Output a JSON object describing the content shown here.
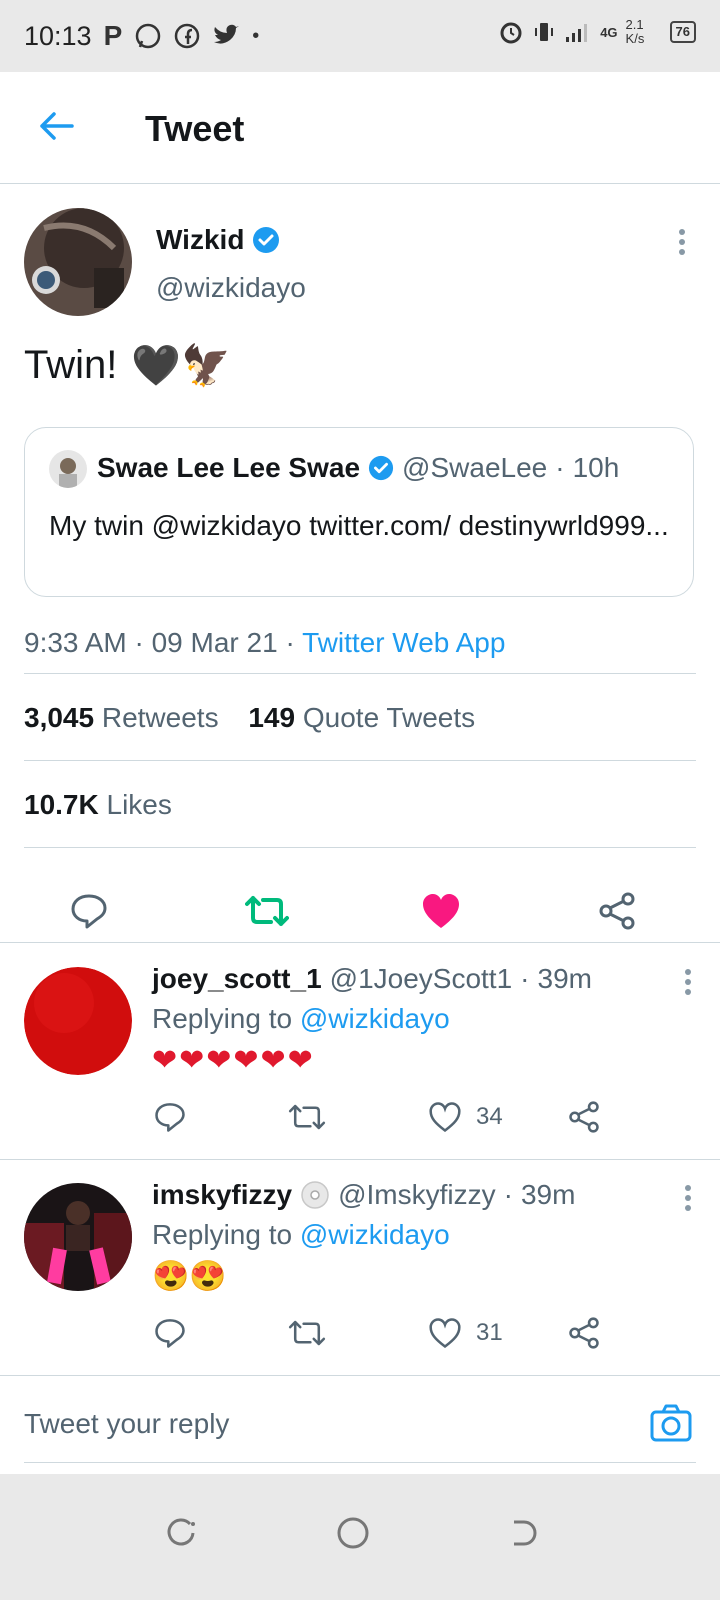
{
  "status_bar": {
    "time": "10:13",
    "network": "4G",
    "speed": "2.1 K/s",
    "battery": "76"
  },
  "header": {
    "title": "Tweet"
  },
  "tweet": {
    "author_name": "Wizkid",
    "author_handle": "@wizkidayo",
    "text": "Twin!",
    "emojis": "🖤🦅",
    "quoted": {
      "name": "Swae Lee Lee Swae",
      "handle": "@SwaeLee",
      "time": "10h",
      "text": "My twin @wizkidayo twitter.com/ destinywrld999..."
    },
    "timestamp": "9:33 AM · 09 Mar 21 · ",
    "source": "Twitter Web App",
    "retweets_count": "3,045",
    "retweets_label": "Retweets",
    "quotes_count": "149",
    "quotes_label": "Quote Tweets",
    "likes_count": "10.7K",
    "likes_label": "Likes"
  },
  "replies": [
    {
      "name": "joey_scott_1",
      "handle": "@1JoeyScott1",
      "time": "39m",
      "replying_label": "Replying to ",
      "replying_to": "@wizkidayo",
      "text": "❤❤❤❤❤❤",
      "likes": "34"
    },
    {
      "name": "imskyfizzy",
      "handle": "@Imskyfizzy",
      "time": "39m",
      "replying_label": "Replying to ",
      "replying_to": "@wizkidayo",
      "text": "😍😍",
      "likes": "31"
    }
  ],
  "composer": {
    "placeholder": "Tweet your reply"
  },
  "colors": {
    "accent": "#1d9bf0",
    "retweet": "#00ba7c",
    "like": "#f91880",
    "muted": "#536471"
  }
}
